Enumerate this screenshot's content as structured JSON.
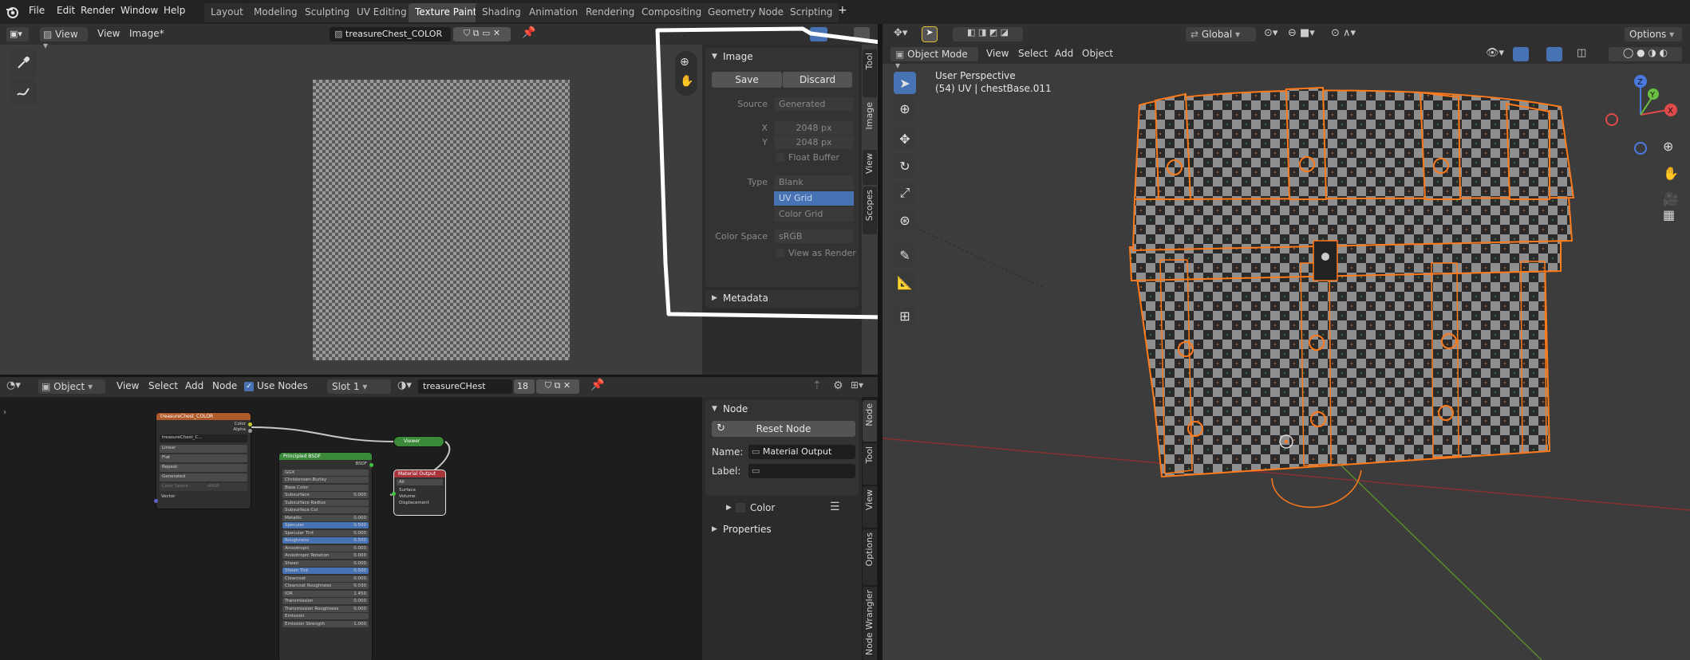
{
  "topbar": {
    "menus": [
      "File",
      "Edit",
      "Render",
      "Window",
      "Help"
    ],
    "workspaces": [
      "Layout",
      "Modeling",
      "Sculpting",
      "UV Editing",
      "Texture Paint",
      "Shading",
      "Animation",
      "Rendering",
      "Compositing",
      "Geometry Nodes",
      "Scripting"
    ],
    "active_workspace": "Texture Paint",
    "add_tab": "+"
  },
  "image_editor": {
    "view_mode": "View",
    "menus": [
      "View",
      "Image*"
    ],
    "image_name": "treasureChest_COLOR",
    "panel": {
      "title": "Image",
      "save": "Save",
      "discard": "Discard",
      "source_label": "Source",
      "source_value": "Generated",
      "x_label": "X",
      "x_value": "2048 px",
      "y_label": "Y",
      "y_value": "2048 px",
      "float_buffer": "Float Buffer",
      "type_label": "Type",
      "type_options": [
        "Blank",
        "UV Grid",
        "Color Grid"
      ],
      "type_selected": "UV Grid",
      "color_space_label": "Color Space",
      "color_space_value": "sRGB",
      "view_as_render": "View as Render",
      "metadata": "Metadata"
    },
    "side_tabs": [
      "Tool",
      "Image",
      "View",
      "Scopes"
    ]
  },
  "node_editor": {
    "editor_type": "Object",
    "menus": [
      "View",
      "Select",
      "Add",
      "Node"
    ],
    "use_nodes": "Use Nodes",
    "slot": "Slot 1",
    "material": "treasureCHest",
    "users": "18",
    "panel": {
      "title": "Node",
      "reset": "Reset Node",
      "name_label": "Name:",
      "name_value": "Material Output",
      "label_label": "Label:",
      "label_value": "",
      "color": "Color",
      "properties": "Properties"
    },
    "side_tabs": [
      "Node",
      "Tool",
      "View",
      "Options",
      "Node Wrangler"
    ],
    "nodes": {
      "image_texture": {
        "title": "treasureChest_COLOR",
        "out_color": "Color",
        "out_alpha": "Alpha",
        "image": "treasureChest_C...",
        "rows": [
          "Linear",
          "Flat",
          "Repeat",
          "Generated"
        ],
        "color_space_label": "Color Space",
        "color_space_value": "sRGB",
        "in_vector": "Vector"
      },
      "viewer": {
        "title": "Viewer"
      },
      "output": {
        "title": "Material Output",
        "target": "All",
        "inputs": [
          "Surface",
          "Volume",
          "Displacement"
        ]
      },
      "bsdf": {
        "title": "Principled BSDF",
        "out": "BSDF",
        "rows": [
          {
            "label": "GGX",
            "value": ""
          },
          {
            "label": "Christensen-Burley",
            "value": ""
          },
          {
            "label": "Base Color",
            "value": ""
          },
          {
            "label": "Subsurface",
            "value": "0.000"
          },
          {
            "label": "Subsurface Radius",
            "value": ""
          },
          {
            "label": "Subsurface Col",
            "value": ""
          },
          {
            "label": "Metallic",
            "value": "0.000"
          },
          {
            "label": "Specular",
            "value": "0.500"
          },
          {
            "label": "Specular Tint",
            "value": "0.000"
          },
          {
            "label": "Roughness",
            "value": "0.500"
          },
          {
            "label": "Anisotropic",
            "value": "0.000"
          },
          {
            "label": "Anisotropic Rotation",
            "value": "0.000"
          },
          {
            "label": "Sheen",
            "value": "0.000"
          },
          {
            "label": "Sheen Tint",
            "value": "0.500"
          },
          {
            "label": "Clearcoat",
            "value": "0.000"
          },
          {
            "label": "Clearcoat Roughness",
            "value": "0.030"
          },
          {
            "label": "IOR",
            "value": "1.450"
          },
          {
            "label": "Transmission",
            "value": "0.000"
          },
          {
            "label": "Transmission Roughness",
            "value": "0.000"
          },
          {
            "label": "Emission",
            "value": ""
          },
          {
            "label": "Emission Strength",
            "value": "1.000"
          }
        ]
      }
    }
  },
  "viewport": {
    "orientation": "Global",
    "options": "Options",
    "mode": "Object Mode",
    "menus": [
      "View",
      "Select",
      "Add",
      "Object"
    ],
    "perspective": "User Perspective",
    "object_info": "(54) UV | chestBase.011",
    "gizmo": {
      "z": "Z",
      "y": "Y",
      "x": "X"
    }
  },
  "colors": {
    "accent": "#4772b3",
    "selection": "#ff7a1a",
    "annotation": "#ffffff",
    "header": "#303030",
    "panel": "#2b2b2b"
  }
}
